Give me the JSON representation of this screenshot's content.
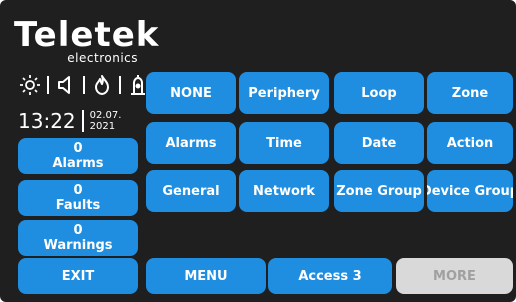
{
  "logo": {
    "brand": "Teletek",
    "sub": "electronics"
  },
  "status_icons": [
    "sun-icon",
    "speaker-icon",
    "flame-icon",
    "user-alarm-icon"
  ],
  "clock": {
    "time": "13:22",
    "date_line1": "02.07.",
    "date_line2": "2021"
  },
  "status_buttons": [
    {
      "count": "0",
      "label": "Alarms"
    },
    {
      "count": "0",
      "label": "Faults"
    },
    {
      "count": "0",
      "label": "Warnings"
    }
  ],
  "filter_buttons": [
    "NONE",
    "Periphery",
    "Loop",
    "Zone",
    "Alarms",
    "Time",
    "Date",
    "Action",
    "General",
    "Network",
    "Zone Group",
    "Device Group"
  ],
  "bottom_bar": {
    "exit": "EXIT",
    "menu": "MENU",
    "access": "Access 3",
    "more": "MORE"
  },
  "colors": {
    "background": "#1f1f1f",
    "button": "#1f8ee0",
    "disabled_button": "#d9d9d9",
    "text": "#ffffff"
  }
}
